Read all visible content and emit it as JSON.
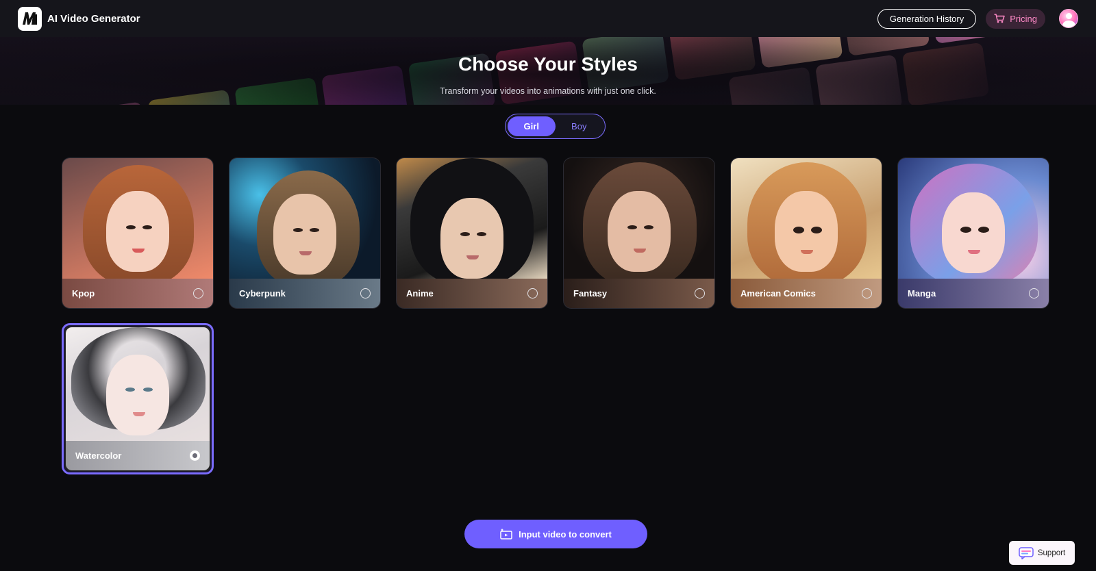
{
  "header": {
    "app_title": "AI Video Generator",
    "logo_icon": "mi-logo-icon",
    "history_label": "Generation History",
    "pricing_label": "Pricing",
    "pricing_icon": "cart-icon",
    "avatar_icon": "user-avatar-icon"
  },
  "banner": {
    "title": "Choose Your Styles",
    "subtitle": "Transform your videos into animations with just one click."
  },
  "gender_toggle": {
    "options": [
      {
        "label": "Girl",
        "active": true
      },
      {
        "label": "Boy",
        "active": false
      }
    ]
  },
  "styles": [
    {
      "label": "Kpop",
      "selected": false
    },
    {
      "label": "Cyberpunk",
      "selected": false
    },
    {
      "label": "Anime",
      "selected": false
    },
    {
      "label": "Fantasy",
      "selected": false
    },
    {
      "label": "American Comics",
      "selected": false
    },
    {
      "label": "Manga",
      "selected": false
    },
    {
      "label": "Watercolor",
      "selected": true
    }
  ],
  "convert_button": {
    "label": "Input video to convert",
    "icon": "video-upload-icon"
  },
  "support_button": {
    "label": "Support",
    "icon": "chat-icon"
  },
  "colors": {
    "accent": "#6f5fff",
    "background": "#0b0b0e",
    "topbar": "#15151b",
    "pricing_text": "#ff8ac8"
  }
}
